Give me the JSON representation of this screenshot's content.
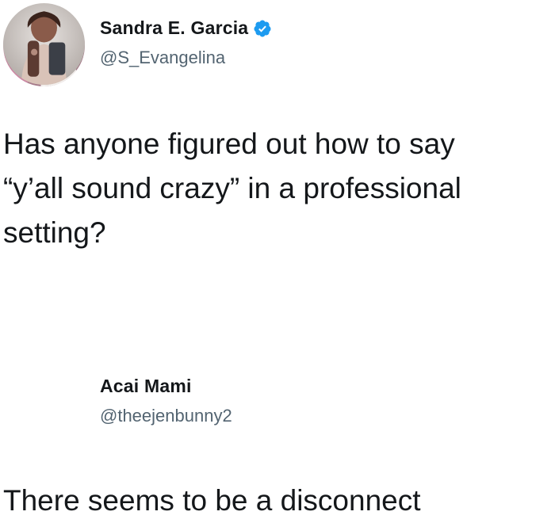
{
  "tweets": [
    {
      "display_name": "Sandra E. Garcia",
      "handle": "@S_Evangelina",
      "verified": true,
      "text_lines": [
        "Has anyone figured out how to say",
        "“y’all sound crazy” in a professional",
        "setting?"
      ],
      "avatar_icon": "avatar-photo-icon",
      "verified_icon": "verified-badge-icon",
      "verified_color": "#1d9bf0"
    },
    {
      "display_name": "Acai Mami",
      "handle": "@theejenbunny2",
      "verified": false,
      "text_lines": [
        "There seems to be a disconnect"
      ],
      "avatar_icon": "avatar-photo-icon"
    }
  ],
  "colors": {
    "background": "#ffffff",
    "text_primary": "#14171a",
    "text_secondary": "#536471"
  }
}
